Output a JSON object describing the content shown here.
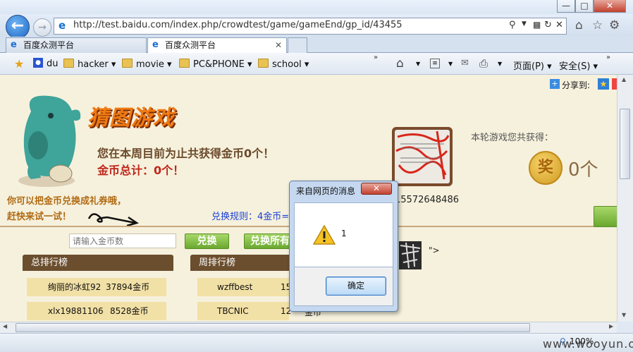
{
  "window": {
    "minimize": "—",
    "maximize": "□",
    "close": "✕"
  },
  "nav": {
    "url": "http://test.baidu.com/index.php/crowdtest/game/gameEnd/gp_id/43455"
  },
  "tabs": [
    {
      "label": "百度众测平台"
    },
    {
      "label": "百度众测平台"
    }
  ],
  "favorites": [
    {
      "label": "du"
    },
    {
      "label": "hacker"
    },
    {
      "label": "movie"
    },
    {
      "label": "PC&PHONE"
    },
    {
      "label": "school"
    }
  ],
  "commandbar": {
    "page": "页面(P)",
    "safety": "安全(S)"
  },
  "page": {
    "share": "分享到:",
    "logo_text": "猜图游戏",
    "weekly_line": "您在本周目前为止共获得金币0个！",
    "total_line": "金币总计：0个！",
    "promo_line1": "你可以把金币兑换成礼券哦，",
    "promo_line2": "赶快来试一试！",
    "exchange_rule": "兑换规则：4金币=",
    "coin_input_placeholder": "请输入金币数",
    "exchange_button": "兑换",
    "exchange_all_button": "兑换所有",
    "round_earn_label": "本轮游戏您共获得：",
    "coin_glyph": "奖",
    "round_earn_value": "0个",
    "phone_partial": "15572648486",
    "injected_text": "\">",
    "total_rank_title": "总排行榜",
    "weekly_rank_title": "周排行榜",
    "total_rank": [
      {
        "name": "绚丽的冰虹92",
        "coins": "37894金币"
      },
      {
        "name": "xlx19881106",
        "coins": "8528金币"
      }
    ],
    "weekly_rank": [
      {
        "name": "wzffbest",
        "coins": "15"
      },
      {
        "name": "TBCNIC",
        "coins": "12"
      }
    ],
    "weekly_rank_suffix": "金币"
  },
  "dialog": {
    "title": "来自网页的消息",
    "close": "✕",
    "message": "1",
    "ok": "确定"
  },
  "status": {
    "zoom": "100%"
  },
  "watermark": "www.wooyun.org"
}
